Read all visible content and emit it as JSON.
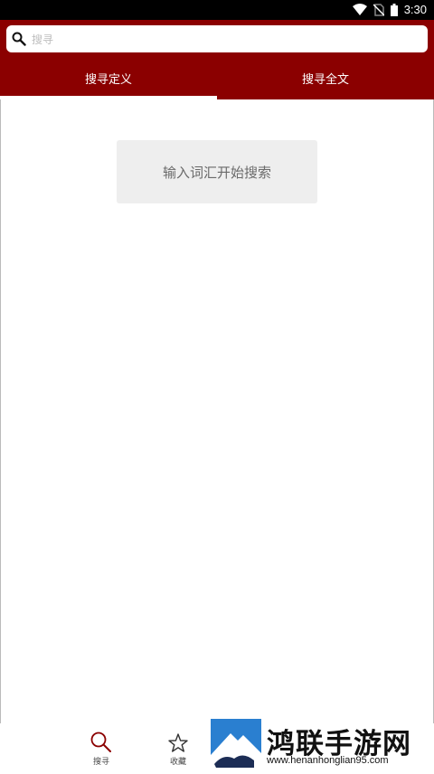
{
  "status_bar": {
    "time": "3:30",
    "icons": [
      "wifi-icon",
      "no-sim-icon",
      "battery-icon"
    ]
  },
  "search": {
    "placeholder": "搜寻",
    "value": ""
  },
  "tabs": [
    {
      "label": "搜寻定义",
      "active": true
    },
    {
      "label": "搜寻全文",
      "active": false
    }
  ],
  "hint": "输入词汇开始搜索",
  "bottom_nav": {
    "search_label": "搜寻",
    "favorites_label": "收藏"
  },
  "watermark": {
    "title": "鸿联手游网",
    "url": "www.henanhonglian95.com"
  },
  "colors": {
    "header": "#8b0000",
    "accent": "#8b0000"
  }
}
